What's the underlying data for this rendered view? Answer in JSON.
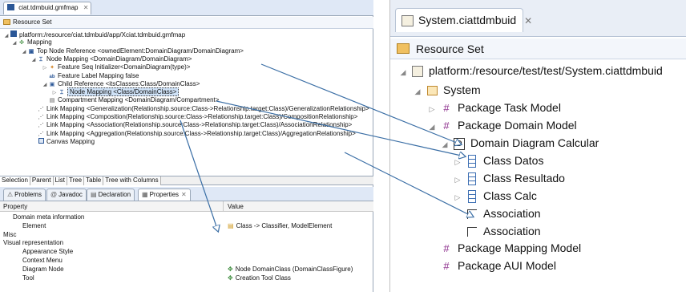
{
  "left": {
    "editor_tab": "ciat.tdmbuid.gmfmap",
    "resource_set": "Resource Set",
    "tree": [
      {
        "id": "root",
        "text": "platform:/resource/ciat.tdmbuid/app/Xciat.tdmbuid.gmfmap",
        "icon": "map-file-icon",
        "expanded": true
      },
      {
        "id": "mapping",
        "text": "Mapping",
        "icon": "mapping-icon",
        "expanded": true
      },
      {
        "id": "top-node",
        "text": "Top Node Reference <ownedElement:DomainDiagram/DomainDiagram>",
        "icon": "top-node-icon",
        "expanded": true
      },
      {
        "id": "node-map-1",
        "text": "Node Mapping <DomainDiagram/DomainDiagram>",
        "icon": "node-mapping-icon",
        "expanded": true
      },
      {
        "id": "feat-seq",
        "text": "Feature Seq Initializer<DomainDiagram(type)>",
        "icon": "feature-seq-icon",
        "expanded": false
      },
      {
        "id": "feat-label",
        "text": "Feature Label Mapping false",
        "icon": "label-icon",
        "expanded": null
      },
      {
        "id": "child-ref",
        "text": "Child Reference <itsClasses:Class/DomainClass>",
        "icon": "child-ref-icon",
        "expanded": true
      },
      {
        "id": "node-map-2",
        "text": "Node Mapping <Class/DomainClass>",
        "icon": "node-mapping-icon",
        "expanded": false,
        "selected": true
      },
      {
        "id": "compartment",
        "text": "Compartment Mapping <DomainDiagram/Compartment>",
        "icon": "compartment-icon",
        "expanded": null
      },
      {
        "id": "link-1",
        "text": "Link Mapping <Generalization(Relationship.source:Class->Relationship.target:Class)/GeneralizationRelationship>",
        "icon": "link-mapping-icon",
        "expanded": null
      },
      {
        "id": "link-2",
        "text": "Link Mapping <Composition(Relationship.source:Class->Relationship.target:Class)/CompositionRelationship>",
        "icon": "link-mapping-icon",
        "expanded": null
      },
      {
        "id": "link-3",
        "text": "Link Mapping <Association(Relationship.source:Class->Relationship.target:Class)/AssociationRelationship>",
        "icon": "link-mapping-icon",
        "expanded": null
      },
      {
        "id": "link-4",
        "text": "Link Mapping <Aggregation(Relationship.source:Class->Relationship.target:Class)/AggregationRelationship>",
        "icon": "link-mapping-icon",
        "expanded": null
      },
      {
        "id": "canvas",
        "text": "Canvas Mapping",
        "icon": "canvas-icon",
        "expanded": null
      }
    ],
    "bottom_tabs": [
      "Selection",
      "Parent",
      "List",
      "Tree",
      "Table",
      "Tree with Columns"
    ],
    "view_tabs": [
      {
        "label": "Problems",
        "icon": "problems-icon"
      },
      {
        "label": "Javadoc",
        "icon": "javadoc-icon"
      },
      {
        "label": "Declaration",
        "icon": "declaration-icon"
      },
      {
        "label": "Properties",
        "icon": "properties-icon",
        "active": true
      }
    ],
    "properties": {
      "col_property": "Property",
      "col_value": "Value",
      "rows": [
        {
          "name": "Domain meta information",
          "value": "",
          "indent": 1
        },
        {
          "name": "Element",
          "value": "Class -> Classifier, ModelElement",
          "value_icon": "class-icon",
          "indent": 2
        },
        {
          "name": "Misc",
          "value": "",
          "indent": 0
        },
        {
          "name": "Visual representation",
          "value": "",
          "indent": 0
        },
        {
          "name": "Appearance Style",
          "value": "",
          "indent": 2
        },
        {
          "name": "Context Menu",
          "value": "",
          "indent": 2
        },
        {
          "name": "Diagram Node",
          "value": "Node DomainClass (DomainClassFigure)",
          "value_icon": "node-icon",
          "indent": 2
        },
        {
          "name": "Tool",
          "value": "Creation Tool Class",
          "value_icon": "tool-icon",
          "indent": 2
        }
      ]
    }
  },
  "right": {
    "editor_tab": "System.ciattdmbuid",
    "resource_set": "Resource Set",
    "tree": [
      {
        "id": "r-root",
        "text": "platform:/resource/test/test/System.ciattdmbuid",
        "icon": "model-file-icon",
        "expanded": true
      },
      {
        "id": "r-system",
        "text": "System",
        "icon": "system-icon",
        "expanded": true
      },
      {
        "id": "r-task",
        "text": "Package Task Model",
        "icon": "package-icon",
        "expanded": false
      },
      {
        "id": "r-domain",
        "text": "Package Domain Model",
        "icon": "package-icon",
        "expanded": true
      },
      {
        "id": "r-diagram",
        "text": "Domain Diagram Calcular",
        "icon": "diagram-icon",
        "expanded": true
      },
      {
        "id": "r-datos",
        "text": "Class Datos",
        "icon": "class-icon",
        "expanded": false
      },
      {
        "id": "r-resultado",
        "text": "Class Resultado",
        "icon": "class-icon",
        "expanded": false
      },
      {
        "id": "r-calc",
        "text": "Class Calc",
        "icon": "class-icon",
        "expanded": false
      },
      {
        "id": "r-assoc-1",
        "text": "Association",
        "icon": "association-icon",
        "expanded": null
      },
      {
        "id": "r-assoc-2",
        "text": "Association",
        "icon": "association-icon",
        "expanded": null
      },
      {
        "id": "r-mapping",
        "text": "Package Mapping Model",
        "icon": "package-icon",
        "expanded": null
      },
      {
        "id": "r-aui",
        "text": "Package AUI Model",
        "icon": "package-icon",
        "expanded": null
      }
    ],
    "diagram_icon_letter": "D"
  },
  "colors": {
    "tab_bg": "#dfe8f6",
    "arrow": "#3a6ea5",
    "package": "#8a2a8a",
    "class": "#3d6fb3",
    "selection": "#cfe2f7"
  }
}
